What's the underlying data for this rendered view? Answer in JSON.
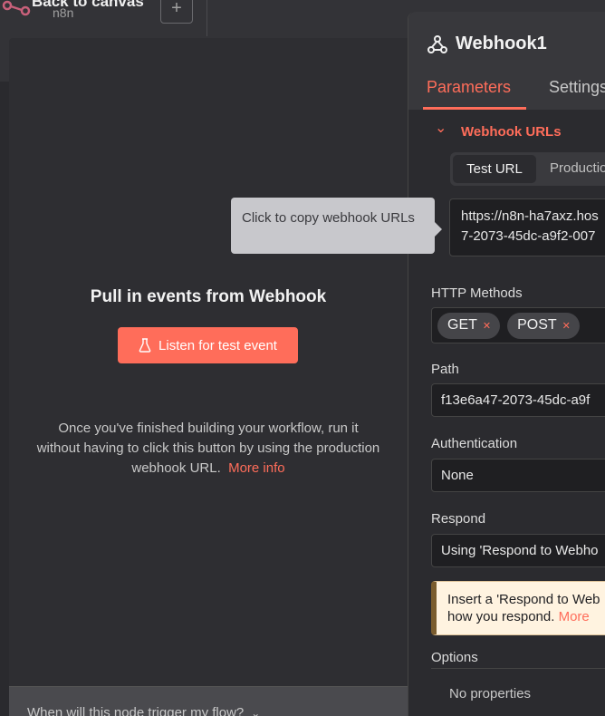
{
  "canvas": {
    "back_label": "Back to canvas",
    "sub_label": "n8n",
    "add_label": "+"
  },
  "input_panel": {
    "title": "Pull in events from Webhook",
    "listen_button": "Listen for test event",
    "info_text": "Once you've finished building your workflow, run it without having to click this button by using the production webhook URL.",
    "info_link": "More info",
    "faq": "When will this node trigger my flow?"
  },
  "tooltip": {
    "text": "Click to copy webhook URLs"
  },
  "node": {
    "title": "Webhook1",
    "tabs": [
      "Parameters",
      "Settings"
    ],
    "webhook_urls": {
      "title": "Webhook URLs",
      "segments": [
        "Test URL",
        "Production"
      ],
      "url_line1": "https://n8n-ha7axz.hos",
      "url_line2": "7-2073-45dc-a9f2-007"
    },
    "http_methods": {
      "label": "HTTP Methods",
      "chips": [
        "GET",
        "POST"
      ]
    },
    "path": {
      "label": "Path",
      "value": "f13e6a47-2073-45dc-a9f"
    },
    "authentication": {
      "label": "Authentication",
      "value": "None"
    },
    "respond": {
      "label": "Respond",
      "value": "Using 'Respond to Webho"
    },
    "warning": {
      "line1": "Insert a 'Respond to Web",
      "line2": "how you respond.",
      "link": "More"
    },
    "options": {
      "label": "Options",
      "empty": "No properties"
    }
  },
  "colors": {
    "accent": "#ff6d5a",
    "background": "#2a2a2e",
    "panel": "#2b2b2f",
    "warning_bg": "#fff3e0"
  }
}
